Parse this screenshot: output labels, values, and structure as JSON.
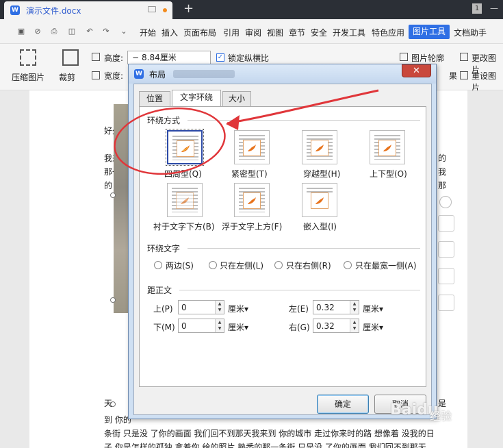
{
  "titlebar": {
    "doc_tab": "演示文件.docx",
    "window_count": "1"
  },
  "menubar": {
    "items": [
      "开始",
      "插入",
      "页面布局",
      "引用",
      "审阅",
      "视图",
      "章节",
      "安全",
      "开发工具",
      "特色应用"
    ],
    "active": "图片工具",
    "after_active": "文档助手"
  },
  "ribbon": {
    "compress": "压缩图片",
    "crop": "裁剪",
    "height_label": "高度:",
    "height_value": "8.84厘米",
    "width_label": "宽度:",
    "lock_ratio": "锁定纵横比",
    "outline": "图片轮廓",
    "change_image": "更改图片",
    "reset_image": "重设图片",
    "effect_partial": "果"
  },
  "document": {
    "line1": "好久不",
    "para1_line1": "我来到",
    "para1_line1_end": "的",
    "para1_line2": "那一条",
    "para1_line2_end": "我",
    "para1_line3": "的日子",
    "para1_line3_end": "那",
    "para2_line0": "天",
    "para2_line0_end": "是",
    "para2_line1": "到 你的",
    "para2_line2": "条街  只是没 了你的画面 我们回不到那天我来到 你的城市 走过你来时的路 想像着 没我的日",
    "para2_line3": "子 你是怎样的孤独 拿着你 给的照片 熟悉的那一条街  只是没 了你的画面 我们回不到那天"
  },
  "dialog": {
    "title": "布局",
    "close": "✕",
    "tabs": [
      "位置",
      "文字环绕",
      "大小"
    ],
    "active_tab": 1,
    "wrap_section": "环绕方式",
    "wrap_options": [
      "四周型(Q)",
      "紧密型(T)",
      "穿越型(H)",
      "上下型(O)",
      "衬于文字下方(B)",
      "浮于文字上方(F)",
      "嵌入型(I)"
    ],
    "wrap_selected": 0,
    "wrap_text_section": "环绕文字",
    "wrap_text_options": [
      "两边(S)",
      "只在左侧(L)",
      "只在右侧(R)",
      "只在最宽一侧(A)"
    ],
    "distance_section": "距正文",
    "distance": {
      "top_label": "上(P)",
      "top_value": "0",
      "bottom_label": "下(M)",
      "bottom_value": "0",
      "left_label": "左(E)",
      "left_value": "0.32",
      "right_label": "右(G)",
      "right_value": "0.32",
      "unit": "厘米▾"
    },
    "ok": "确定",
    "cancel": "取消"
  },
  "watermark": {
    "brand": "Baidu",
    "site": "经验"
  },
  "colors": {
    "accent": "#2f6fe4",
    "annotation": "#e0363a",
    "close_button": "#c9483c"
  }
}
